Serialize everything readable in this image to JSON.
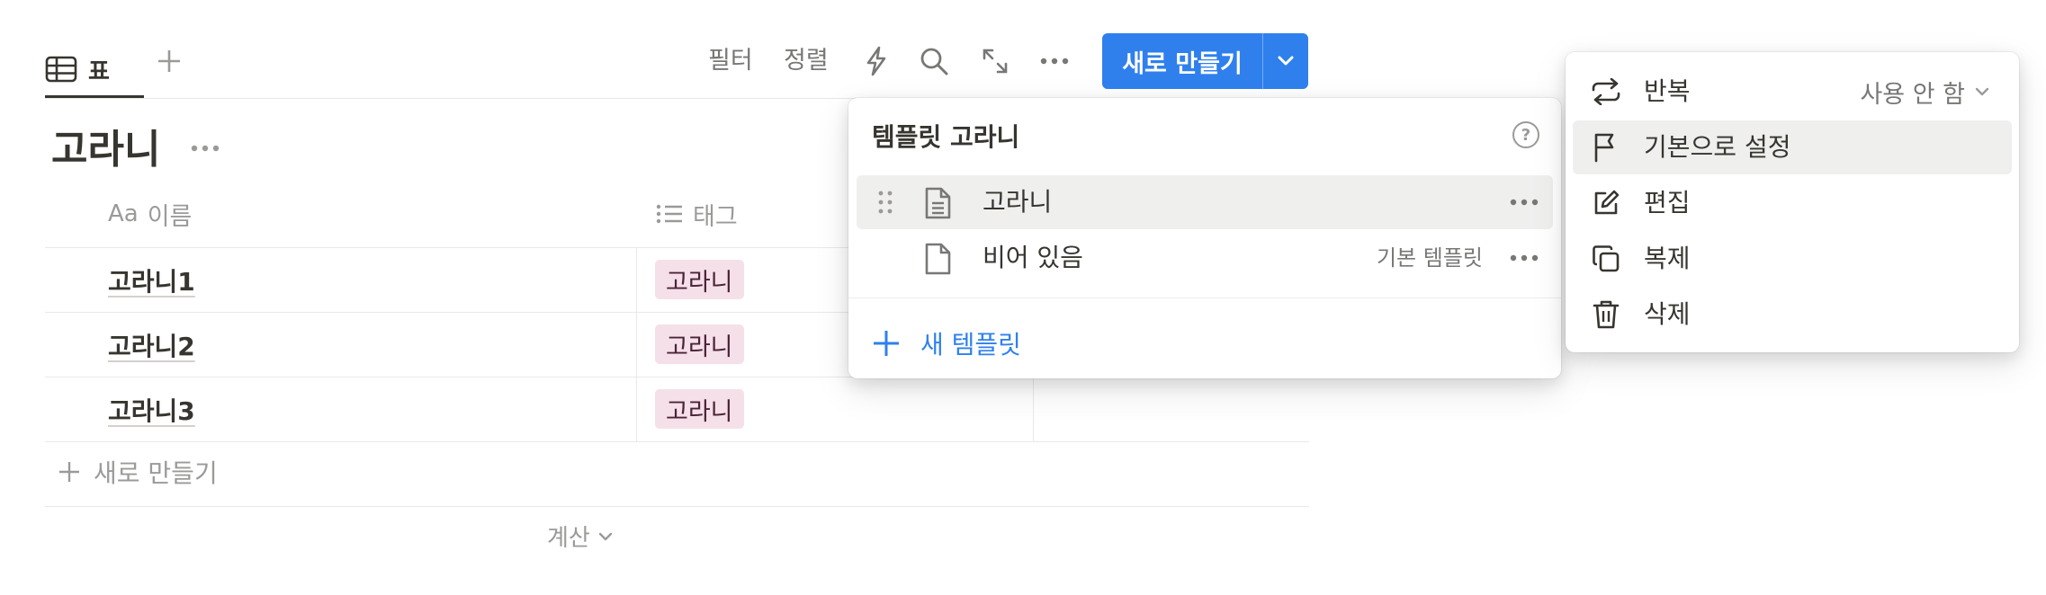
{
  "toolbar": {
    "view_tab_label": "표",
    "filter_label": "필터",
    "sort_label": "정렬",
    "new_button_label": "새로 만들기"
  },
  "database": {
    "title": "고라니",
    "columns": [
      {
        "label": "이름",
        "prefix": "Aa"
      },
      {
        "label": "태그"
      }
    ],
    "rows": [
      {
        "name": "고라니1",
        "tag": "고라니"
      },
      {
        "name": "고라니2",
        "tag": "고라니"
      },
      {
        "name": "고라니3",
        "tag": "고라니"
      }
    ],
    "add_row_label": "새로 만들기",
    "calc_label": "계산"
  },
  "template_popup": {
    "title": "템플릿 고라니",
    "items": [
      {
        "name": "고라니",
        "meta": ""
      },
      {
        "name": "비어 있음",
        "meta": "기본 템플릿"
      }
    ],
    "new_template_label": "새 템플릿"
  },
  "context_menu": {
    "items": [
      {
        "label": "반복",
        "value": "사용 안 함",
        "icon": "repeat-icon"
      },
      {
        "label": "기본으로 설정",
        "icon": "flag-icon"
      },
      {
        "label": "편집",
        "icon": "edit-icon"
      },
      {
        "label": "복제",
        "icon": "duplicate-icon"
      },
      {
        "label": "삭제",
        "icon": "trash-icon"
      }
    ]
  },
  "colors": {
    "accent": "#2f80ed",
    "tag_background": "#f5e0e9",
    "hover_background": "#efefee"
  }
}
